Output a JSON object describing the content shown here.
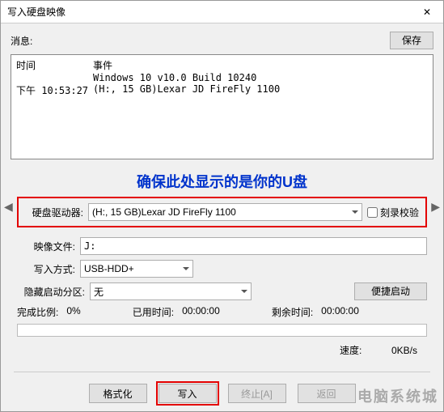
{
  "window": {
    "title": "写入硬盘映像"
  },
  "top": {
    "msg_label": "消息:",
    "save_label": "保存"
  },
  "log": {
    "header_time": "时间",
    "header_event": "事件",
    "rows": [
      {
        "time": "",
        "text": "Windows 10 v10.0 Build 10240"
      },
      {
        "time": "下午 10:53:27",
        "text": "(H:, 15 GB)Lexar   JD FireFly     1100"
      }
    ]
  },
  "annotation": "确保此处显示的是你的U盘",
  "fields": {
    "drive_label": "硬盘驱动器:",
    "drive_value": "(H:, 15 GB)Lexar   JD FireFly     1100",
    "verify_label": "刻录校验",
    "image_label": "映像文件:",
    "image_value": "J:",
    "write_mode_label": "写入方式:",
    "write_mode_value": "USB-HDD+",
    "hidden_boot_label": "隐藏启动分区:",
    "hidden_boot_value": "无",
    "portable_label": "便捷启动"
  },
  "status": {
    "progress_label": "完成比例:",
    "progress_value": "0%",
    "elapsed_label": "已用时间:",
    "elapsed_value": "00:00:00",
    "remaining_label": "剩余时间:",
    "remaining_value": "00:00:00",
    "speed_label": "速度:",
    "speed_value": "0KB/s"
  },
  "buttons": {
    "format": "格式化",
    "write": "写入",
    "abort": "终止[A]",
    "back": "返回"
  },
  "watermark": "电脑系统城"
}
